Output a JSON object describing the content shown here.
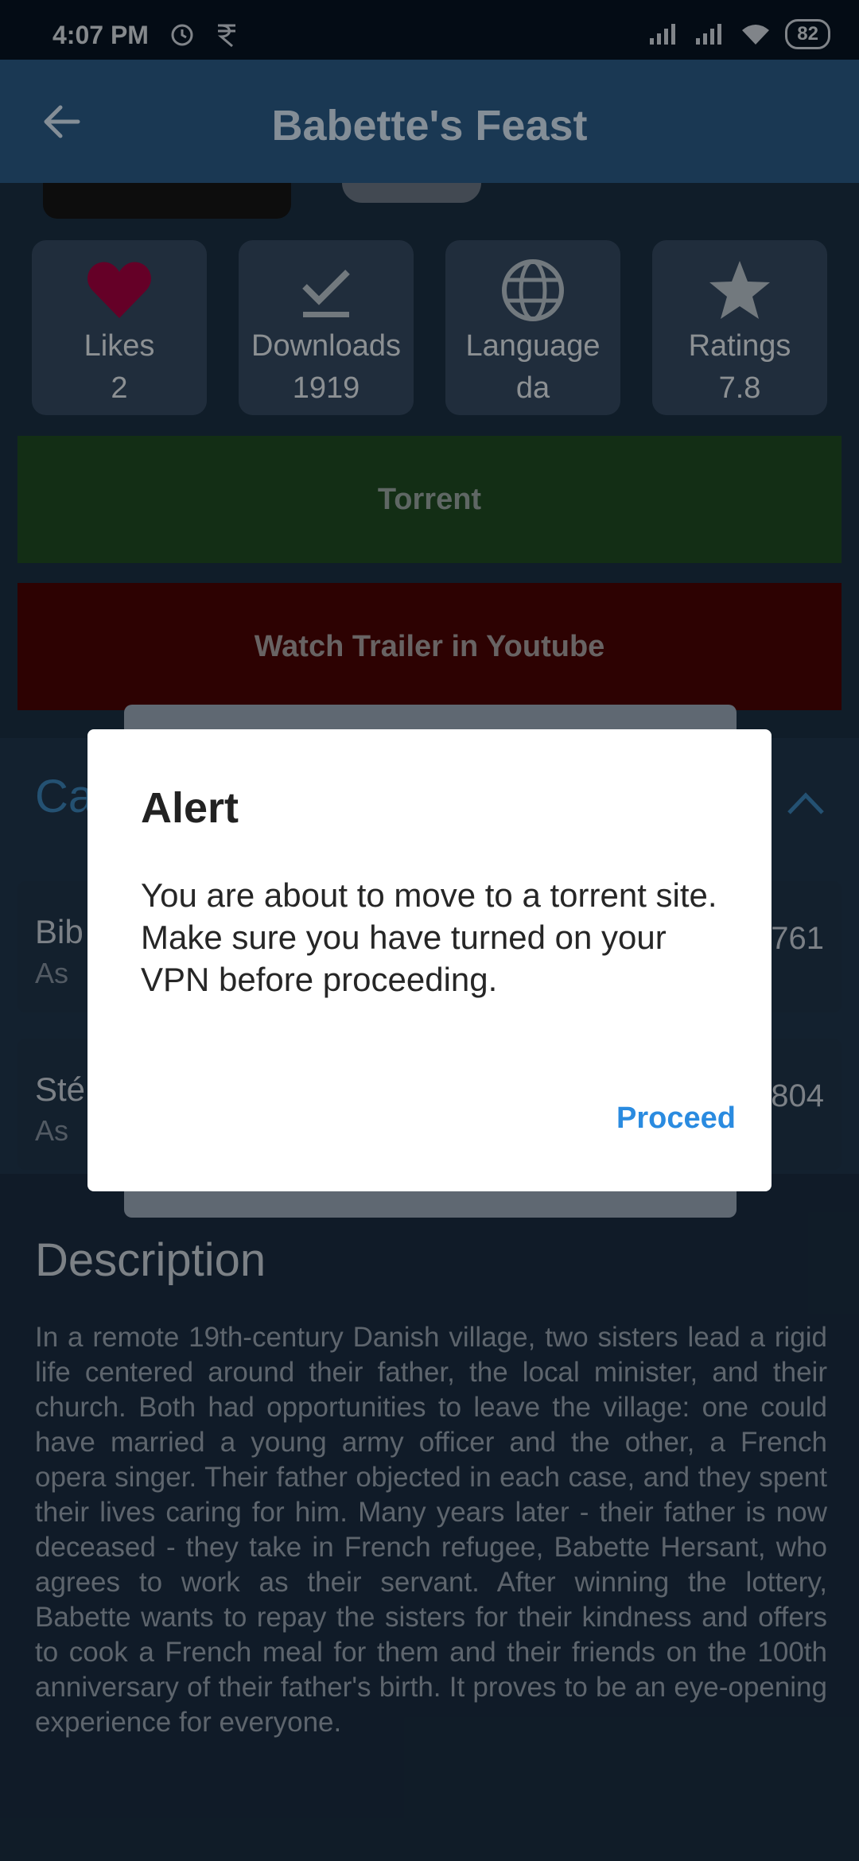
{
  "status_bar": {
    "time": "4:07 PM",
    "battery": "82",
    "icons": [
      "alarm-icon",
      "rupee-icon",
      "signal-icon",
      "signal-icon",
      "wifi-icon",
      "battery-icon"
    ]
  },
  "app_bar": {
    "title": "Babette's Feast"
  },
  "stats": [
    {
      "label": "Likes",
      "value": "2",
      "icon": "heart-icon"
    },
    {
      "label": "Downloads",
      "value": "1919",
      "icon": "download-check-icon"
    },
    {
      "label": "Language",
      "value": "da",
      "icon": "globe-icon"
    },
    {
      "label": "Ratings",
      "value": "7.8",
      "icon": "star-icon"
    }
  ],
  "buttons": {
    "torrent": "Torrent",
    "trailer": "Watch Trailer in Youtube"
  },
  "cast": {
    "heading": "Ca",
    "items": [
      {
        "name": "Bib",
        "role": "As",
        "id": "761"
      },
      {
        "name": "Sté",
        "role": "As",
        "id": "804"
      }
    ]
  },
  "description": {
    "heading": "Description",
    "text": "In a remote 19th-century Danish village, two sisters lead a rigid life centered around their father, the local minister, and their church. Both had opportunities to leave the village: one could have married a young army officer and the other, a French opera singer. Their father objected in each case, and they spent their lives caring for him. Many years later - their father is now deceased - they take in French refugee, Babette Hersant, who agrees to work as their servant. After winning the lottery, Babette wants to repay the sisters for their kindness and offers to cook a French meal for them and their friends on the 100th anniversary of their father's birth. It proves to be an eye-opening experience for everyone."
  },
  "dialog": {
    "title": "Alert",
    "message": "You are about to move to a torrent site. Make sure you have turned on your VPN before proceeding.",
    "proceed": "Proceed"
  },
  "colors": {
    "accent": "#2a8be0",
    "heart": "#e0005c",
    "torrent_bg": "#2f8a36",
    "trailer_bg": "#c90000"
  }
}
